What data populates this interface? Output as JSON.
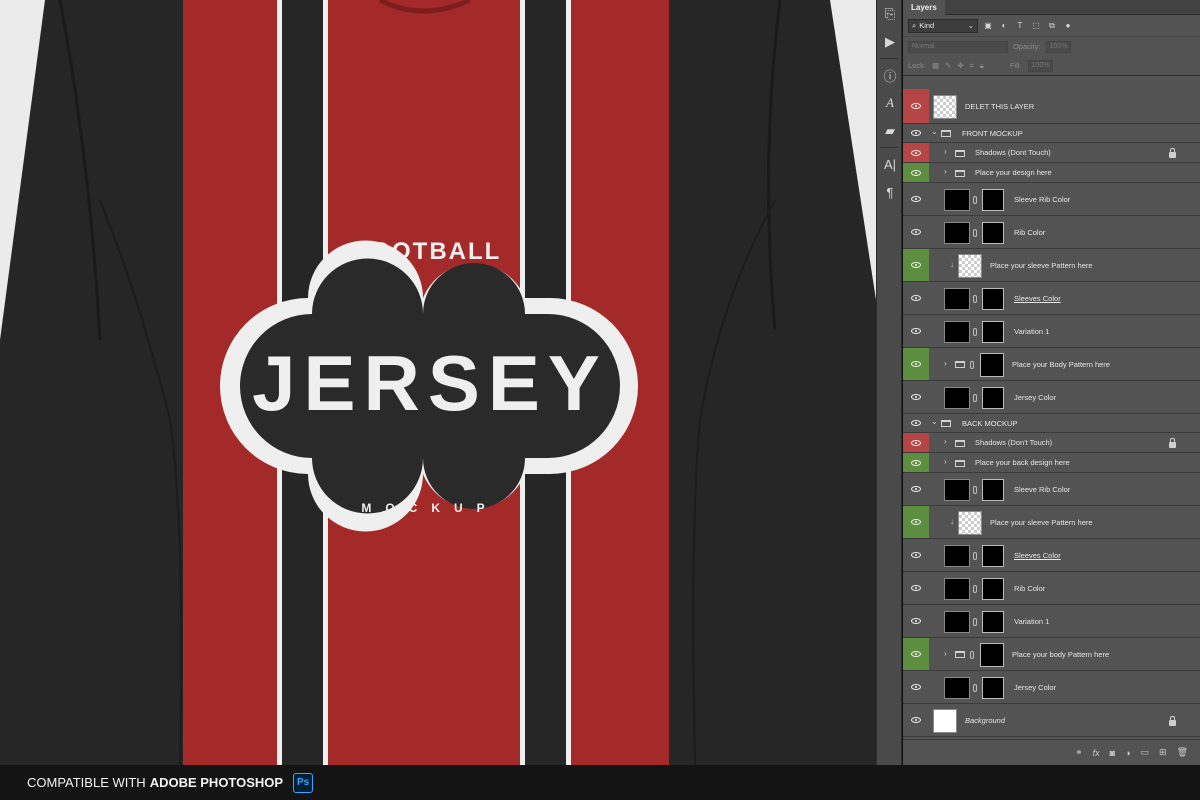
{
  "artwork": {
    "football": "FOOTBALL",
    "jersey": "JERSEY",
    "mockup": "MOCKUP",
    "colors": {
      "jersey_black": "#232323",
      "stripe_red": "#a32a28",
      "badge_fill": "#2b2a2a",
      "stroke": "#efefef"
    }
  },
  "toolstrip": {
    "icons": [
      "history-icon",
      "play-icon",
      "info-icon",
      "character-icon",
      "comment-icon",
      "paragraph-style-icon",
      "paragraph-icon"
    ]
  },
  "panel": {
    "tab": "Layers",
    "kind_label": "Kind",
    "blend_mode": "Normal",
    "opacity_label": "Opacity:",
    "opacity_value": "100%",
    "lock_label": "Lock:",
    "fill_label": "Fill:",
    "fill_value": "100%"
  },
  "layers": [
    {
      "name": "DELET THIS LAYER",
      "vis": "red",
      "type": "checker"
    },
    {
      "name": "FRONT MOCKUP",
      "vis": "none",
      "type": "group"
    },
    {
      "name": "Shadows (Dont Touch)",
      "vis": "red",
      "type": "subgroup",
      "locked": true
    },
    {
      "name": "Place your design here",
      "vis": "green",
      "type": "subgroup"
    },
    {
      "name": "Sleeve Rib Color",
      "vis": "none",
      "type": "masked"
    },
    {
      "name": "Rib Color",
      "vis": "none",
      "type": "masked"
    },
    {
      "name": "Place your sleeve Pattern here",
      "vis": "green",
      "type": "clip"
    },
    {
      "name": "Sleeves Color",
      "vis": "none",
      "type": "masked",
      "underline": true
    },
    {
      "name": "Variation 1",
      "vis": "none",
      "type": "masked"
    },
    {
      "name": "Place your Body Pattern here",
      "vis": "green",
      "type": "groupmask"
    },
    {
      "name": "Jersey Color",
      "vis": "none",
      "type": "masked"
    },
    {
      "name": "BACK MOCKUP",
      "vis": "none",
      "type": "group"
    },
    {
      "name": "Shadows (Don't Touch)",
      "vis": "red",
      "type": "subgroup",
      "locked": true
    },
    {
      "name": "Place your back design here",
      "vis": "green",
      "type": "subgroup"
    },
    {
      "name": "Sleeve Rib Color",
      "vis": "none",
      "type": "masked"
    },
    {
      "name": "Place your sleeve Pattern here",
      "vis": "green",
      "type": "clip"
    },
    {
      "name": "Sleeves Color",
      "vis": "none",
      "type": "masked",
      "underline": true
    },
    {
      "name": "Rib Color",
      "vis": "none",
      "type": "masked"
    },
    {
      "name": "Variation 1",
      "vis": "none",
      "type": "masked"
    },
    {
      "name": "Place your body Pattern here",
      "vis": "green",
      "type": "groupmask"
    },
    {
      "name": "Jersey Color",
      "vis": "none",
      "type": "masked"
    },
    {
      "name": "Background",
      "vis": "none",
      "type": "background",
      "locked": true,
      "italic": true
    }
  ],
  "footer_icons": [
    "link-layers-icon",
    "fx-icon",
    "add-mask-icon",
    "adjustment-icon",
    "new-group-icon",
    "new-layer-icon",
    "trash-icon"
  ],
  "bottom_bar": {
    "prefix": "COMPATIBLE WITH",
    "product": "ADOBE PHOTOSHOP",
    "badge": "Ps"
  }
}
